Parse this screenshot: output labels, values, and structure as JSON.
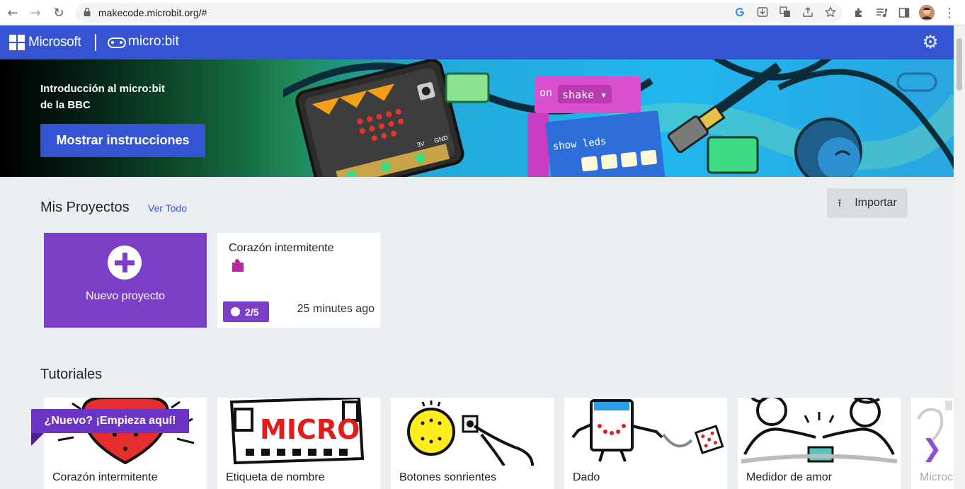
{
  "browser": {
    "url": "makecode.microbit.org/#",
    "back_icon": "←",
    "forward_icon": "→",
    "reload_icon": "↻",
    "menu_icon": "⋮"
  },
  "header": {
    "brand": "Microsoft",
    "product": "micro:bit",
    "settings_icon": "⚙"
  },
  "hero": {
    "title_line1": "Introducción al micro:bit",
    "title_line2": "de la BBC",
    "button_label": "Mostrar instrucciones",
    "art": {
      "block_on": "on",
      "block_shake": "shake ▾",
      "block_show_leds": "show leds",
      "pin_gnd": "GND",
      "pin_3v": "3V"
    }
  },
  "projects": {
    "title": "Mis Proyectos",
    "view_all": "Ver Todo",
    "import_label": "Importar",
    "import_icon": "⭱",
    "new_project_label": "Nuevo proyecto",
    "items": [
      {
        "name": "Corazón intermitente",
        "progress": "2/5",
        "time": "25 minutes ago"
      }
    ]
  },
  "tutorials": {
    "title": "Tutoriales",
    "new_badge": "¿Nuevo? ¡Empieza aquí!",
    "items": [
      {
        "label": "Corazón intermitente"
      },
      {
        "label": "Etiqueta de nombre",
        "art_text": "MICRO"
      },
      {
        "label": "Botones sonrientes"
      },
      {
        "label": "Dado"
      },
      {
        "label": "Medidor de amor"
      },
      {
        "label": "Microc"
      }
    ],
    "next_icon": "❯"
  },
  "colors": {
    "header_blue": "#3454d1",
    "purple": "#7b3fc7",
    "page_bg": "#ebeef0"
  }
}
